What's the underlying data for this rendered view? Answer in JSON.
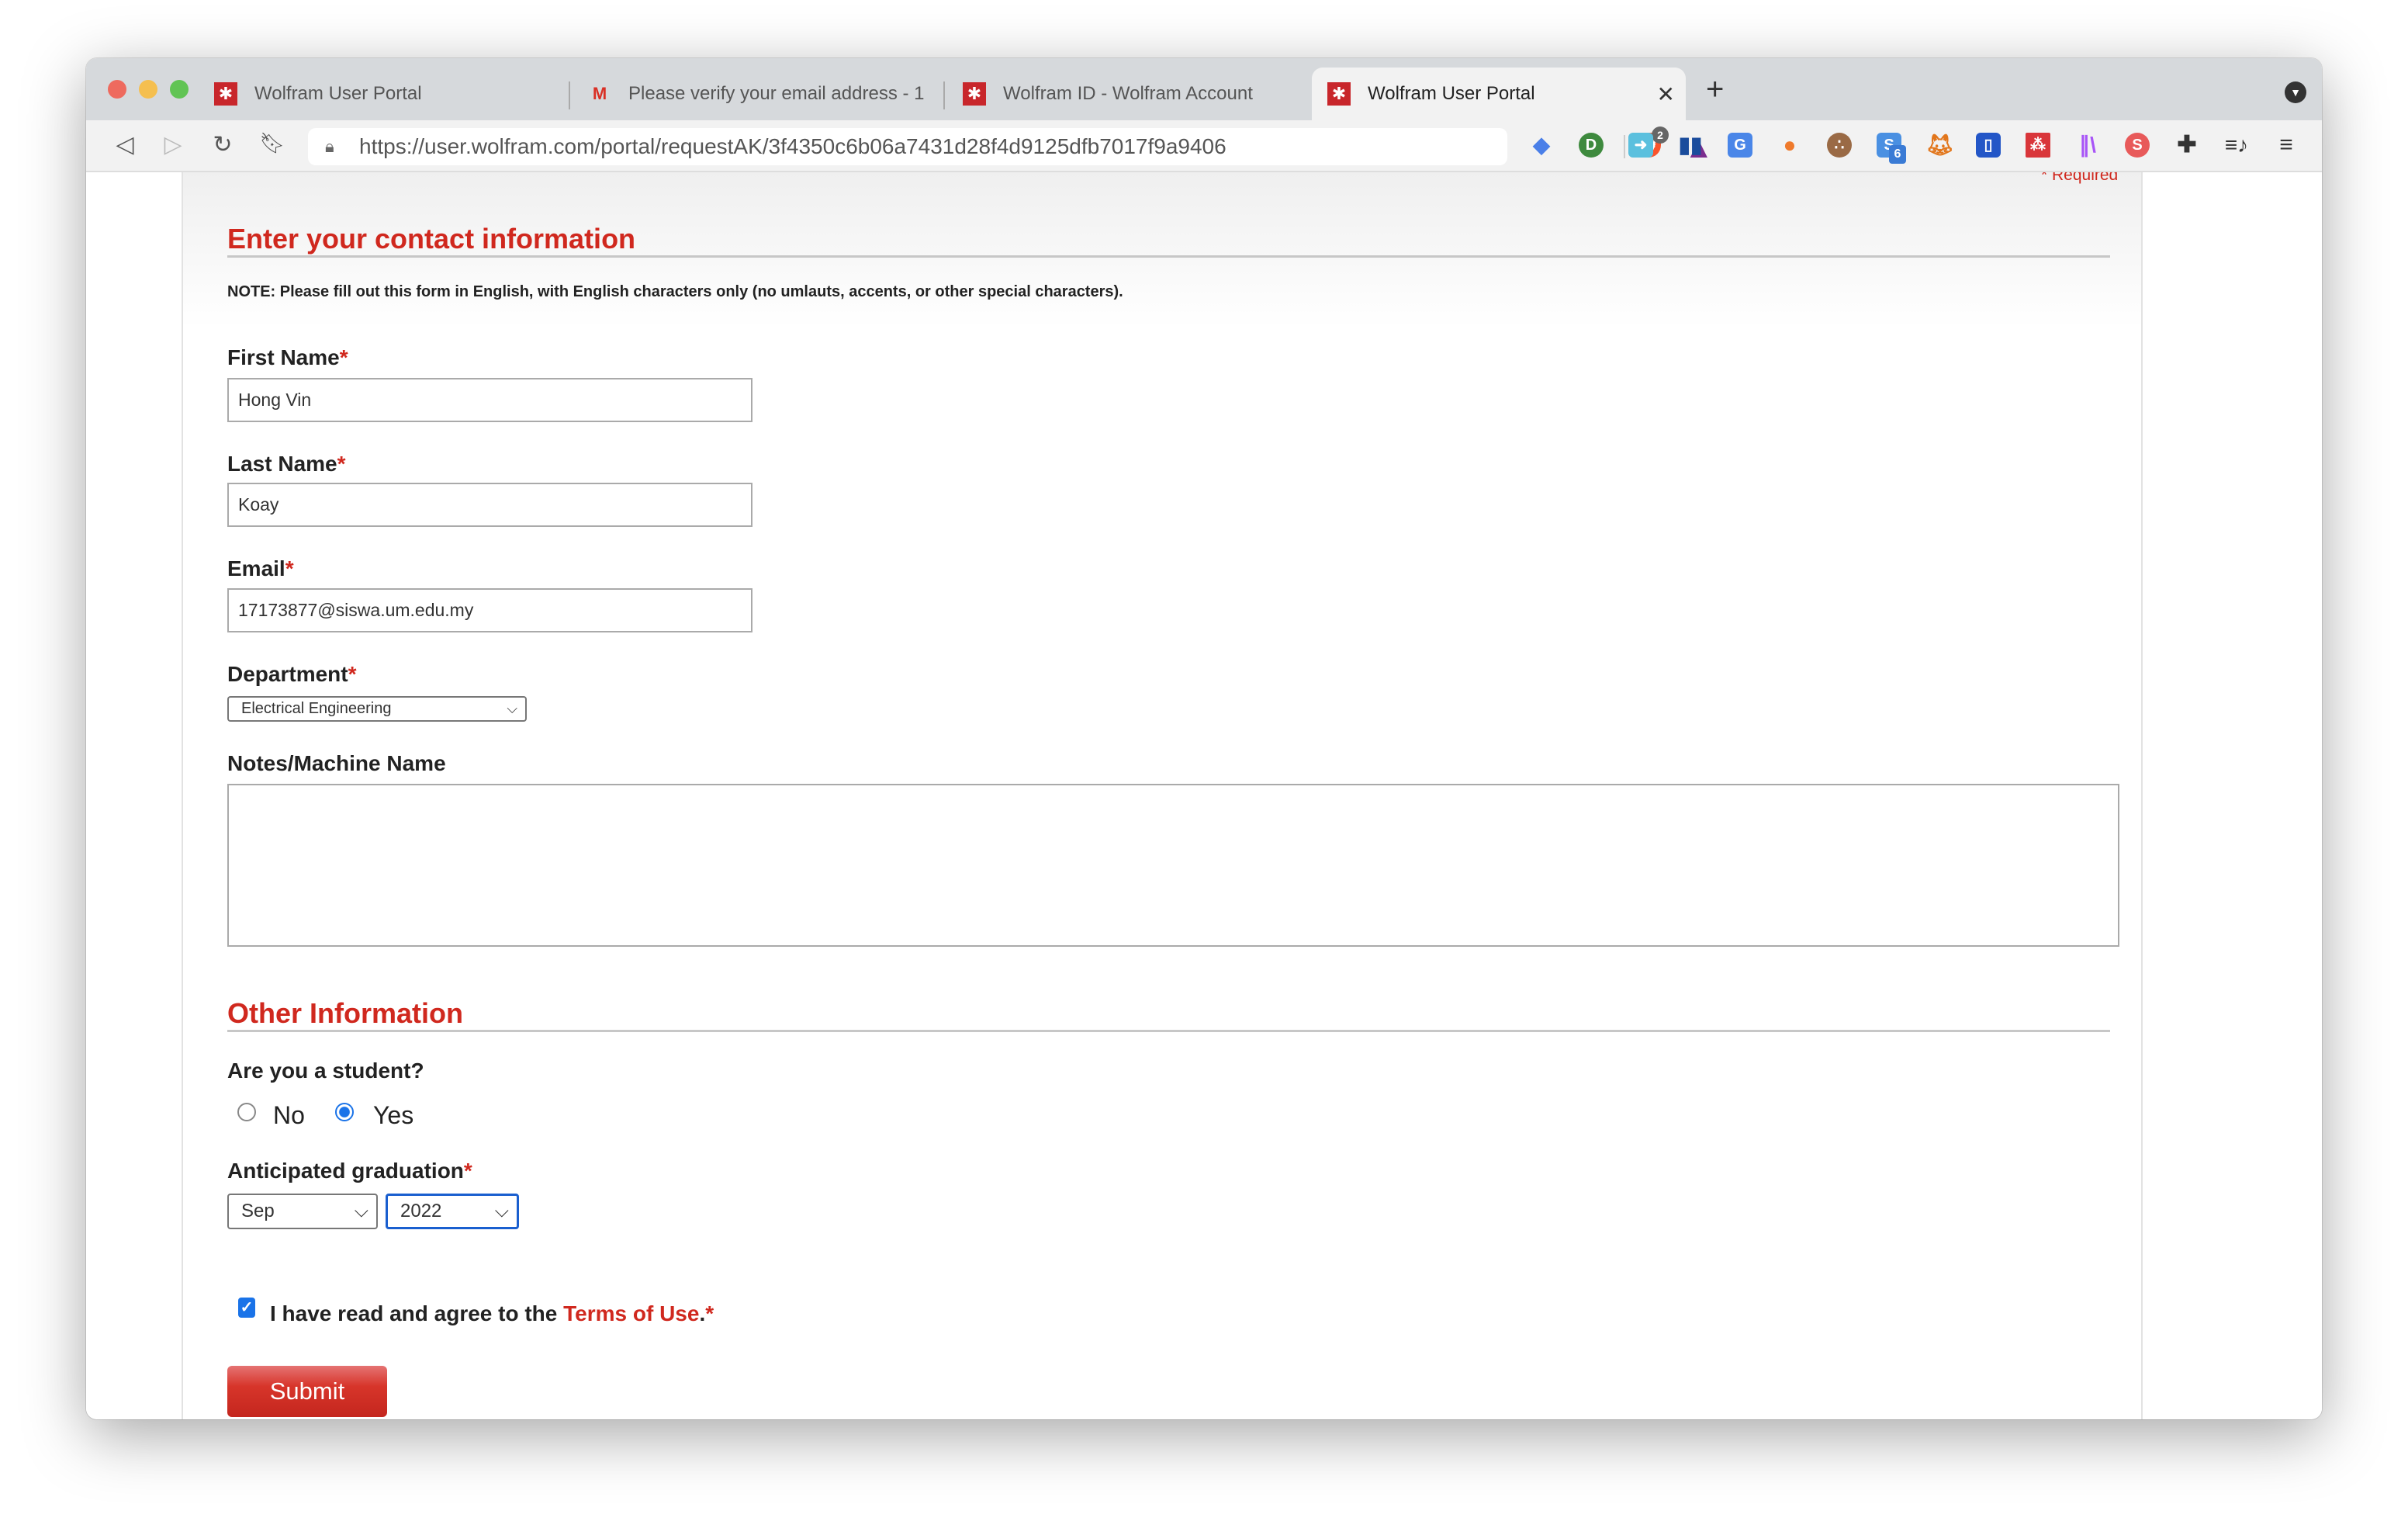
{
  "browser": {
    "tabs": [
      {
        "title": "Wolfram User Portal",
        "icon": "wolfram-icon"
      },
      {
        "title": "Please verify your email address - 1",
        "icon": "gmail-icon"
      },
      {
        "title": "Wolfram ID - Wolfram Account",
        "icon": "wolfram-icon"
      },
      {
        "title": "Wolfram User Portal",
        "icon": "wolfram-icon",
        "active": true
      }
    ],
    "url": "https://user.wolfram.com/portal/requestAK/3f4350c6b06a7431d28f4d9125dfb7017f9a9406",
    "brave_badge": "2",
    "ext_badge": "6"
  },
  "form": {
    "required_note": "* Required",
    "section1_title": "Enter your contact information",
    "note": "NOTE: Please fill out this form in English, with English characters only (no umlauts, accents, or other special characters).",
    "first_name_label": "First Name",
    "first_name": "Hong Vin",
    "last_name_label": "Last Name",
    "last_name": "Koay",
    "email_label": "Email",
    "email": "17173877@siswa.um.edu.my",
    "department_label": "Department",
    "department": "Electrical Engineering",
    "notes_label": "Notes/Machine Name",
    "notes": "",
    "required_mark": "*",
    "section2_title": "Other Information",
    "student_label": "Are you a student?",
    "student_no": "No",
    "student_yes": "Yes",
    "student_selected": "Yes",
    "graduation_label": "Anticipated graduation",
    "graduation_month": "Sep",
    "graduation_year": "2022",
    "agree_text": "I have read and agree to the ",
    "terms_link": "Terms of Use",
    "agree_suffix": ".",
    "agree_checked": true,
    "submit": "Submit"
  },
  "colors": {
    "accent": "#d0281e",
    "focus": "#1a73e8"
  }
}
